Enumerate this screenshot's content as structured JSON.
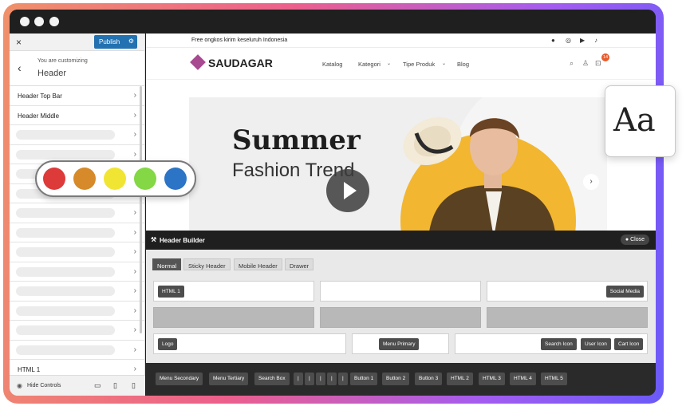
{
  "sidebar": {
    "close_icon": "×",
    "publish_label": "Publish",
    "customizing_label": "You are customizing",
    "section_title": "Header",
    "items": [
      {
        "label": "Header Top Bar"
      },
      {
        "label": "Header Middle"
      }
    ],
    "last_item_label": "HTML 1",
    "footer": {
      "hide_controls_label": "Hide Controls"
    }
  },
  "site": {
    "topbar_text": "Free ongkos kirim keseluruh Indonesia",
    "social_icons": [
      "facebook-icon",
      "instagram-icon",
      "youtube-icon",
      "tiktok-icon"
    ],
    "logo_text": "SAUDAGAR",
    "nav": [
      {
        "label": "Katalog"
      },
      {
        "label": "Kategori"
      },
      {
        "label": "Tipe Produk"
      },
      {
        "label": "Blog"
      }
    ],
    "cart_count": "14"
  },
  "hero": {
    "title": "Summer",
    "subtitle": "Fashion Trend"
  },
  "header_builder": {
    "title": "Header Builder",
    "close_label": "Close",
    "tabs": [
      {
        "label": "Normal",
        "active": true
      },
      {
        "label": "Sticky Header"
      },
      {
        "label": "Mobile Header"
      },
      {
        "label": "Drawer"
      }
    ],
    "rows": {
      "top_left_chip": "HTML 1",
      "top_right_chip": "Social Media",
      "bottom_left_chip": "Logo",
      "bottom_center_chip": "Menu Primary",
      "bottom_right_chips": [
        "Search Icon",
        "User Icon",
        "Cart Icon"
      ]
    },
    "available": [
      "Menu Secondary",
      "Menu Tertiary",
      "Search Box",
      "|",
      "|",
      "|",
      "|",
      "|",
      "Button 1",
      "Button 2",
      "Button 3",
      "HTML 2",
      "HTML 3",
      "HTML 4",
      "HTML 5"
    ]
  },
  "swatch_colors": [
    "#dd3a3a",
    "#d68a2a",
    "#f1e534",
    "#84d745",
    "#2b74c6"
  ],
  "typography_badge": "Aa"
}
